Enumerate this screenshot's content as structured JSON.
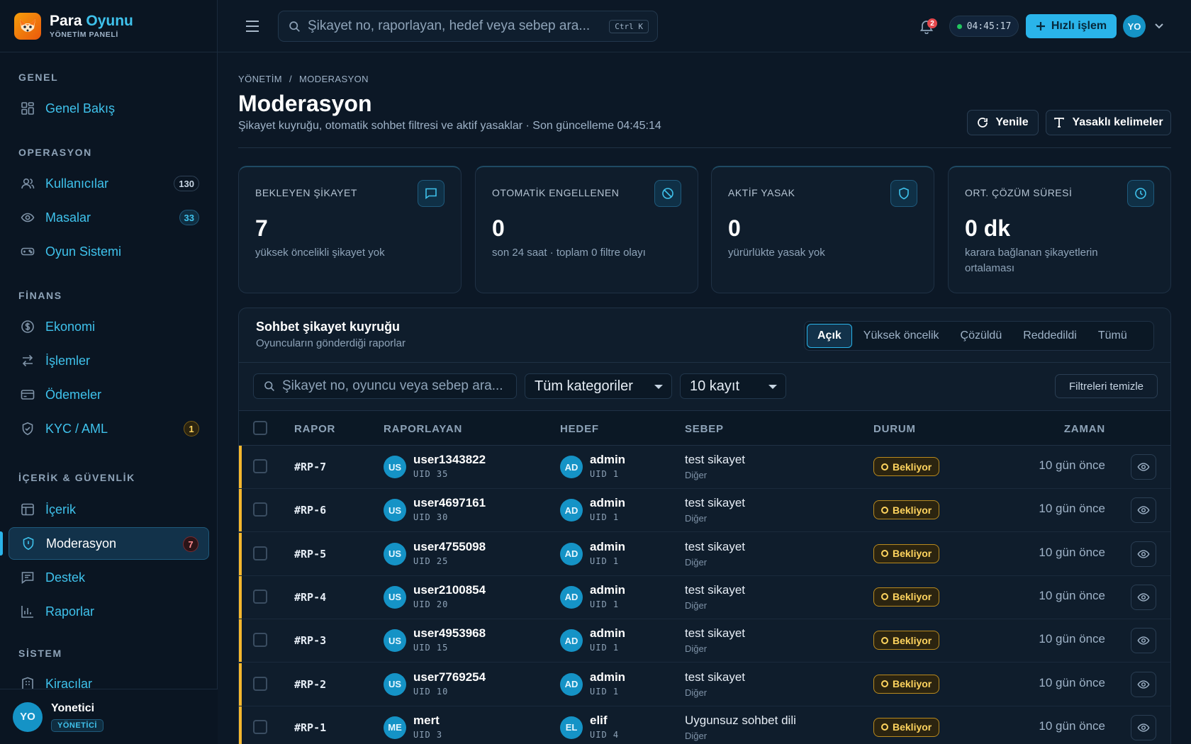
{
  "brand": {
    "name_part1": "Para",
    "name_part2": "Oyunu",
    "subtitle": "YÖNETİM PANELİ"
  },
  "sidebar": {
    "sections": [
      {
        "label": "GENEL"
      },
      {
        "label": "OPERASYON"
      },
      {
        "label": "FİNANS"
      },
      {
        "label": "İÇERİK & GÜVENLİK"
      },
      {
        "label": "SİSTEM"
      }
    ],
    "items": [
      {
        "label": "Genel Bakış",
        "icon": "grid-icon"
      },
      {
        "label": "Kullanıcılar",
        "icon": "users-icon",
        "badge": "130"
      },
      {
        "label": "Masalar",
        "icon": "eye-icon",
        "badge": "33"
      },
      {
        "label": "Oyun Sistemi",
        "icon": "gamepad-icon"
      },
      {
        "label": "Ekonomi",
        "icon": "coin-icon"
      },
      {
        "label": "İşlemler",
        "icon": "transfer-icon"
      },
      {
        "label": "Ödemeler",
        "icon": "card-icon"
      },
      {
        "label": "KYC / AML",
        "icon": "shield-check-icon",
        "badge": "1"
      },
      {
        "label": "İçerik",
        "icon": "layout-icon"
      },
      {
        "label": "Moderasyon",
        "icon": "shield-icon",
        "badge": "7",
        "active": true
      },
      {
        "label": "Destek",
        "icon": "message-icon"
      },
      {
        "label": "Raporlar",
        "icon": "bar-chart-icon"
      },
      {
        "label": "Kiracılar",
        "icon": "building-icon"
      }
    ],
    "user": {
      "initials": "YO",
      "name": "Yonetici",
      "role": "YÖNETİCİ"
    }
  },
  "topbar": {
    "search_placeholder": "Şikayet no, raporlayan, hedef veya sebep ara...",
    "shortcut": "Ctrl K",
    "notification_count": "2",
    "clock": "04:45:17",
    "quick_action": "Hızlı işlem",
    "avatar": "YO"
  },
  "page": {
    "breadcrumb": [
      "YÖNETİM",
      "/",
      "MODERASYON"
    ],
    "title": "Moderasyon",
    "subtitle": "Şikayet kuyruğu, otomatik sohbet filtresi ve aktif yasaklar · Son güncelleme 04:45:14",
    "refresh_label": "Yenile",
    "banned_words_label": "Yasaklı kelimeler"
  },
  "stats": [
    {
      "label": "BEKLEYEN ŞİKAYET",
      "value": "7",
      "desc": "yüksek öncelikli şikayet yok",
      "icon": "chat-icon"
    },
    {
      "label": "OTOMATİK ENGELLENEN",
      "value": "0",
      "desc": "son 24 saat · toplam 0 filtre olayı",
      "icon": "ban-icon"
    },
    {
      "label": "AKTİF YASAK",
      "value": "0",
      "desc": "yürürlükte yasak yok",
      "icon": "shield-icon"
    },
    {
      "label": "ORT. ÇÖZÜM SÜRESİ",
      "value": "0 dk",
      "desc": "karara bağlanan şikayetlerin ortalaması",
      "icon": "clock-icon"
    }
  ],
  "queue": {
    "title": "Sohbet şikayet kuyruğu",
    "subtitle": "Oyuncuların gönderdiği raporlar",
    "tabs": [
      "Açık",
      "Yüksek öncelik",
      "Çözüldü",
      "Reddedildi",
      "Tümü"
    ],
    "active_tab": "Açık",
    "search_placeholder": "Şikayet no, oyuncu veya sebep ara...",
    "category_select": "Tüm kategoriler",
    "page_size_select": "10 kayıt",
    "clear_filters": "Filtreleri temizle",
    "columns": [
      "RAPOR",
      "RAPORLAYAN",
      "HEDEF",
      "SEBEP",
      "DURUM",
      "ZAMAN"
    ],
    "rows": [
      {
        "id": "#RP-7",
        "rep_av": "US",
        "rep_name": "user1343822",
        "rep_uid": "UID 35",
        "tgt_av": "AD",
        "tgt_name": "admin",
        "tgt_uid": "UID 1",
        "reason": "test sikayet",
        "category": "Diğer",
        "status": "Bekliyor",
        "time": "10 gün önce"
      },
      {
        "id": "#RP-6",
        "rep_av": "US",
        "rep_name": "user4697161",
        "rep_uid": "UID 30",
        "tgt_av": "AD",
        "tgt_name": "admin",
        "tgt_uid": "UID 1",
        "reason": "test sikayet",
        "category": "Diğer",
        "status": "Bekliyor",
        "time": "10 gün önce"
      },
      {
        "id": "#RP-5",
        "rep_av": "US",
        "rep_name": "user4755098",
        "rep_uid": "UID 25",
        "tgt_av": "AD",
        "tgt_name": "admin",
        "tgt_uid": "UID 1",
        "reason": "test sikayet",
        "category": "Diğer",
        "status": "Bekliyor",
        "time": "10 gün önce"
      },
      {
        "id": "#RP-4",
        "rep_av": "US",
        "rep_name": "user2100854",
        "rep_uid": "UID 20",
        "tgt_av": "AD",
        "tgt_name": "admin",
        "tgt_uid": "UID 1",
        "reason": "test sikayet",
        "category": "Diğer",
        "status": "Bekliyor",
        "time": "10 gün önce"
      },
      {
        "id": "#RP-3",
        "rep_av": "US",
        "rep_name": "user4953968",
        "rep_uid": "UID 15",
        "tgt_av": "AD",
        "tgt_name": "admin",
        "tgt_uid": "UID 1",
        "reason": "test sikayet",
        "category": "Diğer",
        "status": "Bekliyor",
        "time": "10 gün önce"
      },
      {
        "id": "#RP-2",
        "rep_av": "US",
        "rep_name": "user7769254",
        "rep_uid": "UID 10",
        "tgt_av": "AD",
        "tgt_name": "admin",
        "tgt_uid": "UID 1",
        "reason": "test sikayet",
        "category": "Diğer",
        "status": "Bekliyor",
        "time": "10 gün önce"
      },
      {
        "id": "#RP-1",
        "rep_av": "ME",
        "rep_name": "mert",
        "rep_uid": "UID 3",
        "tgt_av": "EL",
        "tgt_name": "elif",
        "tgt_uid": "UID 4",
        "reason": "Uygunsuz sohbet dili",
        "category": "Diğer",
        "status": "Bekliyor",
        "time": "10 gün önce"
      }
    ]
  },
  "colors": {
    "accent": "#2ab4ea",
    "background": "#0c1826",
    "warning": "#f5b82e"
  }
}
